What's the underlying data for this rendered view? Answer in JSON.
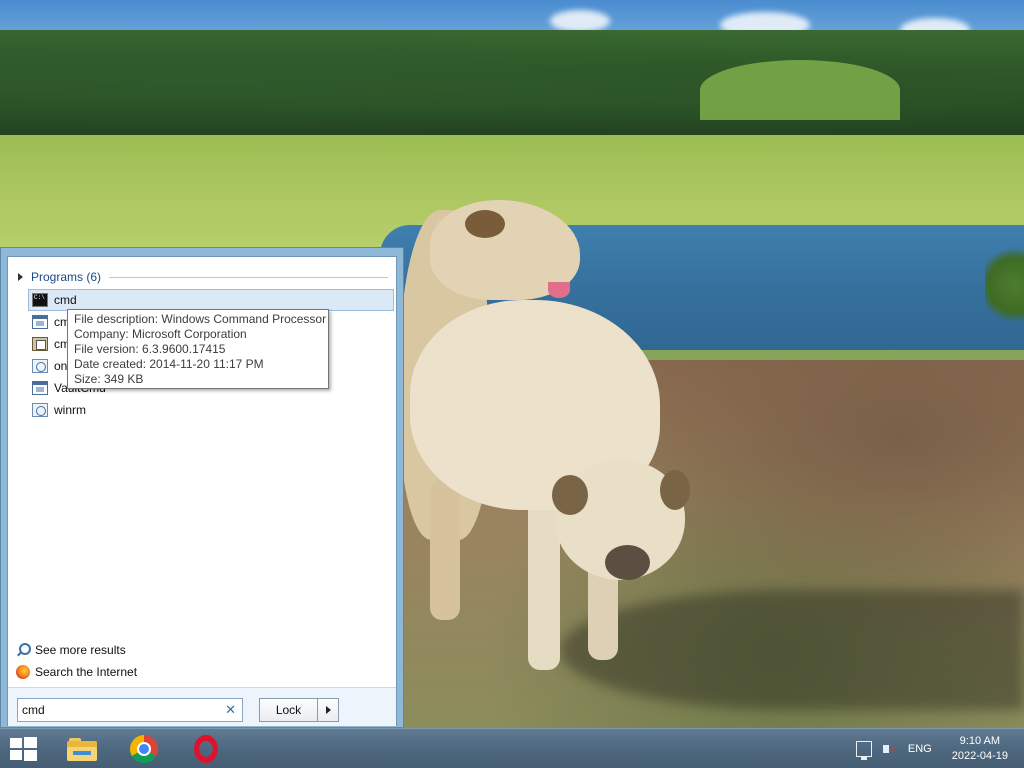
{
  "start_menu": {
    "group_title": "Programs (6)",
    "results": [
      {
        "label": "cmd",
        "icon": "cmd-icon",
        "selected": true
      },
      {
        "label": "cmdl32",
        "icon": "window-app-icon",
        "selected": false
      },
      {
        "label": "cmstp",
        "icon": "tool-app-icon",
        "selected": false
      },
      {
        "label": "onlinesetup",
        "icon": "web-app-icon",
        "selected": false
      },
      {
        "label": "VaultCmd",
        "icon": "window-app-icon",
        "selected": false
      },
      {
        "label": "winrm",
        "icon": "web-app-icon",
        "selected": false
      }
    ],
    "tooltip": {
      "description": "File description: Windows Command Processor",
      "company": "Company: Microsoft Corporation",
      "version": "File version: 6.3.9600.17415",
      "date_created": "Date created: 2014-11-20 11:17 PM",
      "size": "Size: 349 KB"
    },
    "see_more": "See more results",
    "search_internet": "Search the Internet",
    "search": {
      "value": "cmd",
      "clear_glyph": "✕"
    },
    "lock_label": "Lock"
  },
  "taskbar": {
    "pinned": [
      {
        "name": "file-explorer-icon"
      },
      {
        "name": "chrome-icon"
      },
      {
        "name": "opera-icon"
      }
    ],
    "language": "ENG",
    "time": "9:10 AM",
    "date": "2022-04-19"
  },
  "colors": {
    "panel_frame": "#8fb8d6",
    "selection": "#dbe8f6",
    "group_title": "#1a4a8a",
    "taskbar": "#4e687f"
  }
}
